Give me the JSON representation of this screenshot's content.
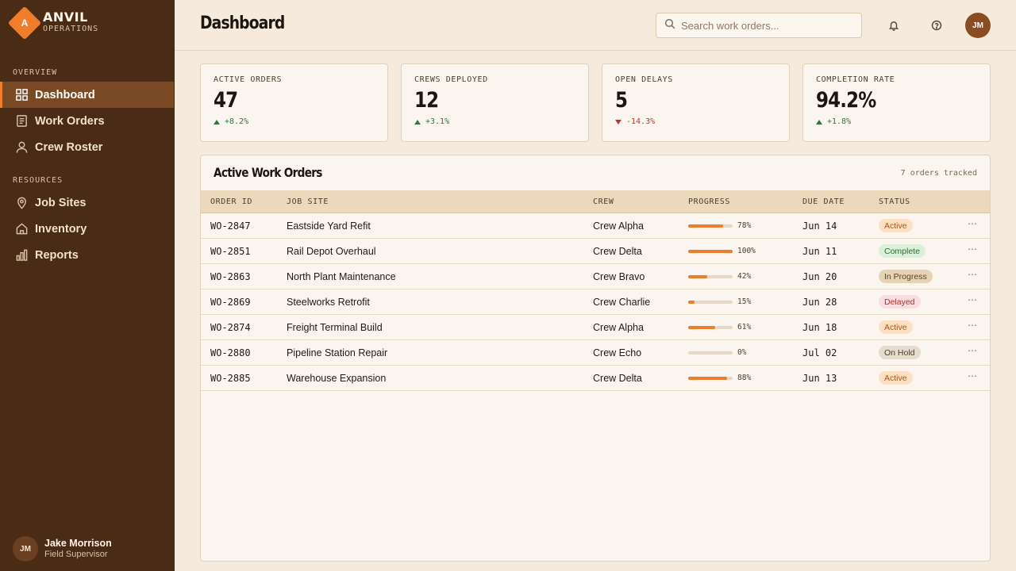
{
  "brand": {
    "letter": "A",
    "name": "ANVIL",
    "sub": "OPERATIONS"
  },
  "sidebar": {
    "sections": [
      {
        "label": "OVERVIEW"
      },
      {
        "label": "RESOURCES"
      }
    ],
    "items": [
      {
        "label": "Dashboard",
        "icon": "grid-icon",
        "active": true
      },
      {
        "label": "Work Orders",
        "icon": "document-icon"
      },
      {
        "label": "Crew Roster",
        "icon": "user-icon"
      },
      {
        "label": "Job Sites",
        "icon": "map-pin-icon"
      },
      {
        "label": "Inventory",
        "icon": "home-icon"
      },
      {
        "label": "Reports",
        "icon": "bar-chart-icon"
      }
    ]
  },
  "user": {
    "initials": "JM",
    "name": "Jake Morrison",
    "role": "Field Supervisor"
  },
  "header": {
    "title": "Dashboard",
    "search_placeholder": "Search work orders...",
    "avatar_initials": "JM"
  },
  "stats": [
    {
      "label": "ACTIVE ORDERS",
      "value": "47",
      "delta": "+8.2%",
      "direction": "up",
      "color": "#2f7a3a"
    },
    {
      "label": "CREWS DEPLOYED",
      "value": "12",
      "delta": "+3.1%",
      "direction": "up",
      "color": "#2f7a3a"
    },
    {
      "label": "OPEN DELAYS",
      "value": "5",
      "delta": "-14.3%",
      "direction": "down",
      "color": "#c0342c"
    },
    {
      "label": "COMPLETION RATE",
      "value": "94.2%",
      "delta": "+1.8%",
      "direction": "up",
      "color": "#2f7a3a"
    }
  ],
  "table": {
    "title": "Active Work Orders",
    "meta": "7 orders tracked",
    "columns": [
      "ORDER ID",
      "JOB SITE",
      "CREW",
      "PROGRESS",
      "DUE DATE",
      "STATUS"
    ],
    "rows": [
      {
        "id": "WO-2847",
        "site": "Eastside Yard Refit",
        "crew": "Crew Alpha",
        "progress": 78,
        "progress_label": "78%",
        "due": "Jun 14",
        "status": "Active"
      },
      {
        "id": "WO-2851",
        "site": "Rail Depot Overhaul",
        "crew": "Crew Delta",
        "progress": 100,
        "progress_label": "100%",
        "due": "Jun 11",
        "status": "Complete"
      },
      {
        "id": "WO-2863",
        "site": "North Plant Maintenance",
        "crew": "Crew Bravo",
        "progress": 42,
        "progress_label": "42%",
        "due": "Jun 20",
        "status": "In Progress"
      },
      {
        "id": "WO-2869",
        "site": "Steelworks Retrofit",
        "crew": "Crew Charlie",
        "progress": 15,
        "progress_label": "15%",
        "due": "Jun 28",
        "status": "Delayed"
      },
      {
        "id": "WO-2874",
        "site": "Freight Terminal Build",
        "crew": "Crew Alpha",
        "progress": 61,
        "progress_label": "61%",
        "due": "Jun 18",
        "status": "Active"
      },
      {
        "id": "WO-2880",
        "site": "Pipeline Station Repair",
        "crew": "Crew Echo",
        "progress": 0,
        "progress_label": "0%",
        "due": "Jul 02",
        "status": "On Hold"
      },
      {
        "id": "WO-2885",
        "site": "Warehouse Expansion",
        "crew": "Crew Delta",
        "progress": 88,
        "progress_label": "88%",
        "due": "Jun 13",
        "status": "Active"
      }
    ]
  },
  "status_colors": {
    "Active": {
      "bg": "#fde0c2",
      "fg": "#b4521a"
    },
    "Complete": {
      "bg": "#dcefd9",
      "fg": "#2f6b34"
    },
    "In Progress": {
      "bg": "#e6d3b6",
      "fg": "#5a4428"
    },
    "Delayed": {
      "bg": "#f8dede",
      "fg": "#b0302c"
    },
    "On Hold": {
      "bg": "#e6dccd",
      "fg": "#4a3e30"
    }
  },
  "accent": "#f07d2c"
}
